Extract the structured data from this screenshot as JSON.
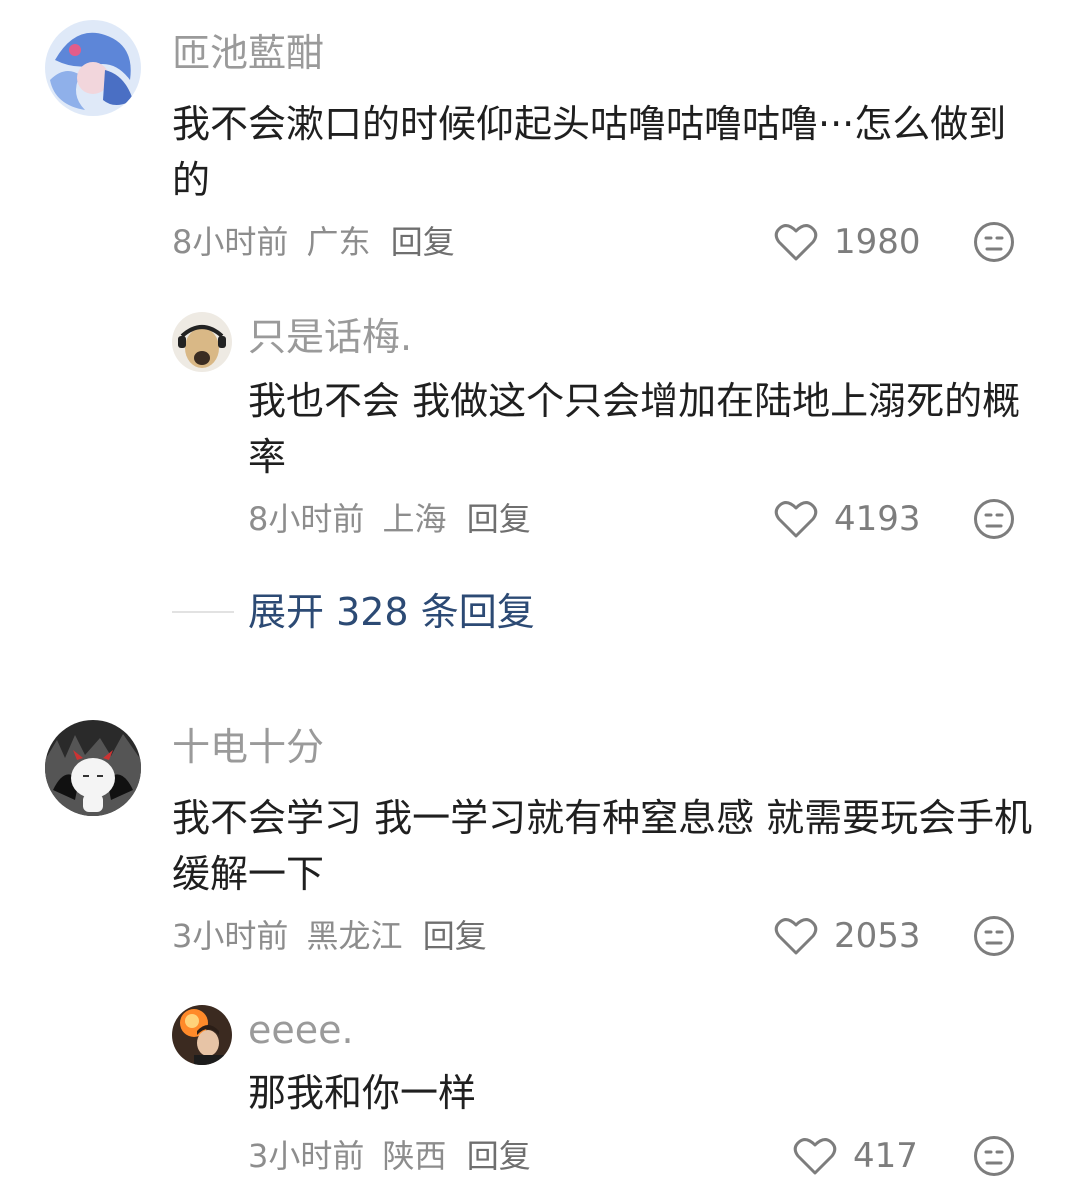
{
  "comments": [
    {
      "username": "匝池藍酣",
      "text": "我不会漱口的时候仰起头咕噜咕噜咕噜···怎么做到的",
      "time": "8小时前",
      "location": "广东",
      "reply_label": "回复",
      "likes": "1980",
      "replies": [
        {
          "username": "只是话梅.",
          "text": "我也不会 我做这个只会增加在陆地上溺死的概率",
          "time": "8小时前",
          "location": "上海",
          "reply_label": "回复",
          "likes": "4193"
        }
      ],
      "expand_label": "展开 328 条回复"
    },
    {
      "username": "十电十分",
      "text": "我不会学习 我一学习就有种窒息感 就需要玩会手机缓解一下",
      "time": "3小时前",
      "location": "黑龙江",
      "reply_label": "回复",
      "likes": "2053",
      "replies": [
        {
          "username": "eeee.",
          "text": "那我和你一样",
          "time": "3小时前",
          "location": "陕西",
          "reply_label": "回复",
          "likes": "417"
        }
      ]
    }
  ],
  "icons": {
    "like": "heart-outline-icon",
    "reaction": "neutral-face-icon"
  },
  "colors": {
    "link": "#2c4a74",
    "username": "#9a9a9a",
    "text": "#1f1f1f"
  }
}
